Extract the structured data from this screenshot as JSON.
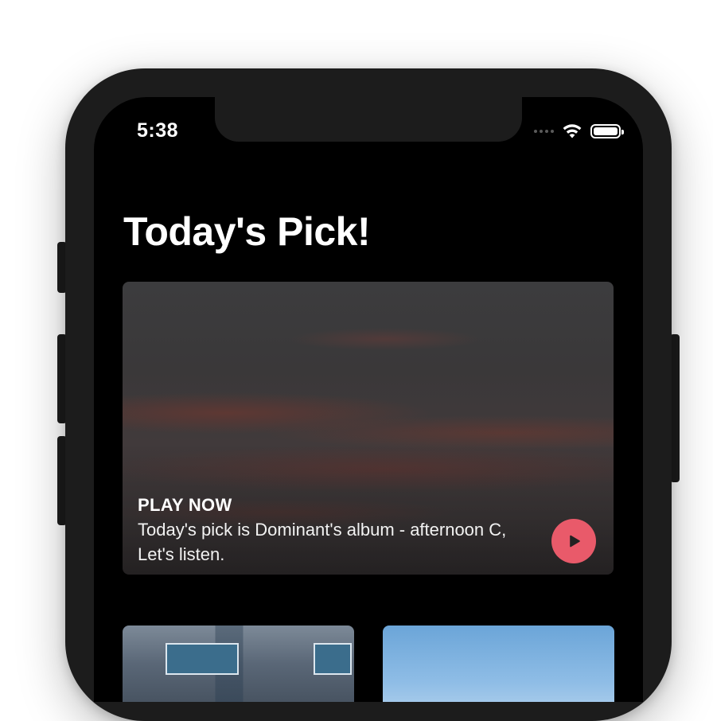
{
  "status_bar": {
    "time": "5:38"
  },
  "page": {
    "title": "Today's Pick!"
  },
  "hero": {
    "kicker": "PLAY NOW",
    "description": "Today's pick is Dominant's album - afternoon C, Let's listen.",
    "play_icon": "play-icon"
  },
  "colors": {
    "background": "#000000",
    "text": "#ffffff",
    "play_button": "#e95a6a",
    "device_frame": "#1c1c1c"
  },
  "icons": [
    "wifi-icon",
    "battery-icon",
    "play-icon"
  ]
}
